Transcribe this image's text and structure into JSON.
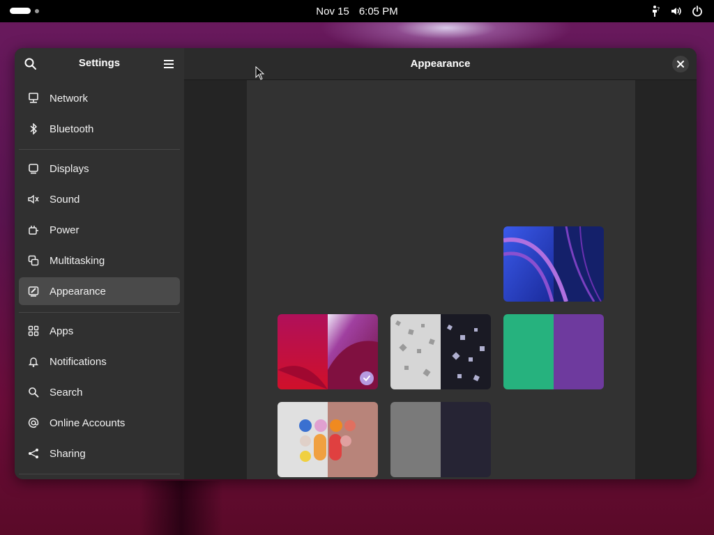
{
  "topbar": {
    "date": "Nov 15",
    "time": "6:05 PM",
    "tray_icons": [
      "accessibility-status-icon",
      "volume-icon",
      "power-icon"
    ]
  },
  "sidebar": {
    "title": "Settings",
    "items": [
      {
        "label": "Network",
        "icon": "network-icon"
      },
      {
        "label": "Bluetooth",
        "icon": "bluetooth-icon"
      },
      {
        "label": "Displays",
        "icon": "display-icon"
      },
      {
        "label": "Sound",
        "icon": "sound-icon"
      },
      {
        "label": "Power",
        "icon": "power-plug-icon"
      },
      {
        "label": "Multitasking",
        "icon": "multitasking-icon"
      },
      {
        "label": "Appearance",
        "icon": "appearance-icon",
        "selected": true
      },
      {
        "label": "Apps",
        "icon": "apps-grid-icon"
      },
      {
        "label": "Notifications",
        "icon": "bell-icon"
      },
      {
        "label": "Search",
        "icon": "search-icon"
      },
      {
        "label": "Online Accounts",
        "icon": "at-sign-icon"
      },
      {
        "label": "Sharing",
        "icon": "share-icon"
      }
    ]
  },
  "main": {
    "title": "Appearance"
  },
  "wallpapers": [
    {
      "name": "blue-ribbons",
      "left": "#2a4ad6",
      "right": "#1a2a8a",
      "selected": false
    },
    {
      "name": "crimson-curves",
      "left": "#b01048",
      "right": "#8a1850",
      "selected": true
    },
    {
      "name": "crystals",
      "left": "#d8d8d8",
      "right": "#2a2a3a",
      "selected": false
    },
    {
      "name": "green-purple",
      "left": "#26b27e",
      "right": "#6e3a9e",
      "selected": false
    },
    {
      "name": "pills",
      "left": "#dcdcdc",
      "right": "#b08078",
      "selected": false
    },
    {
      "name": "gray-dark",
      "left": "#7a7a7a",
      "right": "#262434",
      "selected": false
    }
  ],
  "colors": {
    "selected_check": "#b79be0",
    "sidebar_bg": "#303030",
    "panel_bg": "#323232"
  }
}
